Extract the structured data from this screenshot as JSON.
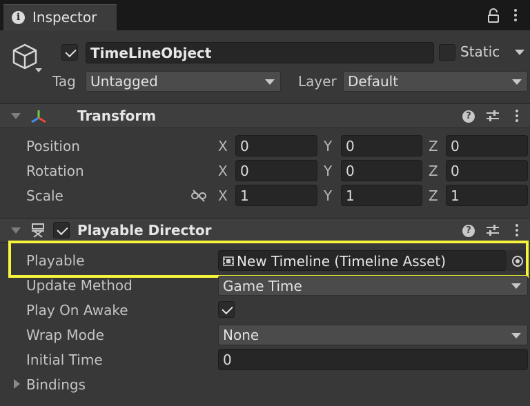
{
  "tab": {
    "label": "Inspector",
    "icon": "info-icon"
  },
  "object": {
    "name": "TimeLineObject",
    "active": true,
    "static_label": "Static",
    "static_checked": false,
    "tag_label": "Tag",
    "tag_value": "Untagged",
    "layer_label": "Layer",
    "layer_value": "Default"
  },
  "transform": {
    "title": "Transform",
    "rows": [
      {
        "label": "Position",
        "x": "0",
        "y": "0",
        "z": "0"
      },
      {
        "label": "Rotation",
        "x": "0",
        "y": "0",
        "z": "0"
      },
      {
        "label": "Scale",
        "x": "1",
        "y": "1",
        "z": "1"
      }
    ],
    "axis_x": "X",
    "axis_y": "Y",
    "axis_z": "Z"
  },
  "playable_director": {
    "title": "Playable Director",
    "enabled": true,
    "playable_label": "Playable",
    "playable_value": "New Timeline (Timeline Asset)",
    "update_method_label": "Update Method",
    "update_method_value": "Game Time",
    "play_on_awake_label": "Play On Awake",
    "play_on_awake": true,
    "wrap_mode_label": "Wrap Mode",
    "wrap_mode_value": "None",
    "initial_time_label": "Initial Time",
    "initial_time_value": "0",
    "bindings_label": "Bindings"
  },
  "colors": {
    "highlight": "#f7f53b",
    "background": "#383838",
    "field": "#262626"
  }
}
